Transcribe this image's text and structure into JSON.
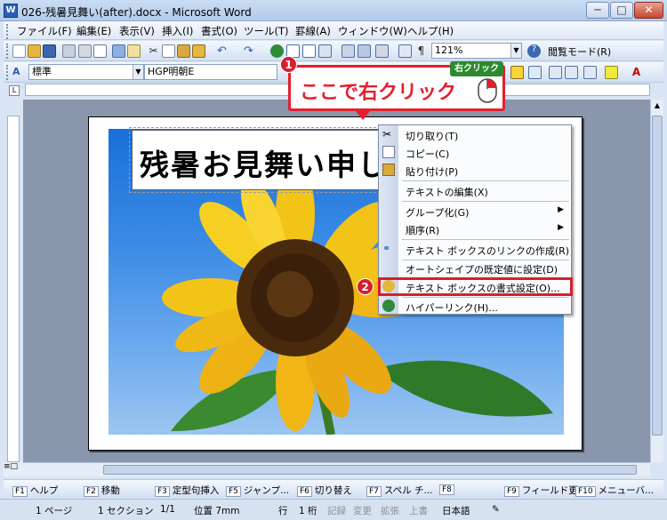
{
  "window": {
    "title": "026-残暑見舞い(after).docx - Microsoft Word",
    "app_icon": "W",
    "min_label": "─",
    "max_label": "□",
    "close_label": "✕"
  },
  "menu": [
    "ファイル(F)",
    "編集(E)",
    "表示(V)",
    "挿入(I)",
    "書式(O)",
    "ツール(T)",
    "罫線(A)",
    "ウィンドウ(W)",
    "ヘルプ(H)"
  ],
  "toolbar": {
    "zoom": "121%",
    "reading_mode": "閲覧モード(R)"
  },
  "format": {
    "style": "標準",
    "font": "HGP明朝E"
  },
  "document": {
    "heading": "残暑お見舞い申し"
  },
  "callout": {
    "step1": "1",
    "text": "ここで右クリック",
    "right_click_label": "右クリック",
    "step2": "2"
  },
  "context_menu": [
    {
      "label": "切り取り(T)",
      "icon": "scissors-icon"
    },
    {
      "label": "コピー(C)",
      "icon": "copy-icon"
    },
    {
      "label": "貼り付け(P)",
      "icon": "paste-icon"
    },
    {
      "label": "テキストの編集(X)",
      "icon": ""
    },
    {
      "label": "グループ化(G)",
      "icon": "",
      "submenu": "▶"
    },
    {
      "label": "順序(R)",
      "icon": "",
      "submenu": "▶"
    },
    {
      "label": "テキスト ボックスのリンクの作成(R)",
      "icon": "link-icon"
    },
    {
      "label": "オートシェイプの既定値に設定(D)",
      "icon": ""
    },
    {
      "label": "テキスト ボックスの書式設定(O)...",
      "icon": "format-icon"
    },
    {
      "label": "ハイパーリンク(H)...",
      "icon": "hyperlink-icon"
    }
  ],
  "fkeys": [
    {
      "key": "F1",
      "label": "ヘルプ"
    },
    {
      "key": "F2",
      "label": "移動"
    },
    {
      "key": "F3",
      "label": "定型句挿入"
    },
    {
      "key": "F5",
      "label": "ジャンプ..."
    },
    {
      "key": "F6",
      "label": "切り替え"
    },
    {
      "key": "F7",
      "label": "スペル チ..."
    },
    {
      "key": "F8",
      "label": ""
    },
    {
      "key": "F9",
      "label": "フィールド更"
    },
    {
      "key": "F10",
      "label": "メニューバ..."
    }
  ],
  "status": {
    "page": "1 ページ",
    "section": "1 セクション",
    "pages": "1/1",
    "position": "位置 7mm",
    "line": "行",
    "col": "1 桁",
    "rec": "記録",
    "trk": "変更",
    "ext": "拡張",
    "ovr": "上書",
    "lang": "日本語"
  },
  "colors": {
    "accent": "#e4202e",
    "menu_highlight": "#d81e2c",
    "sky": "#1a6fd8"
  }
}
